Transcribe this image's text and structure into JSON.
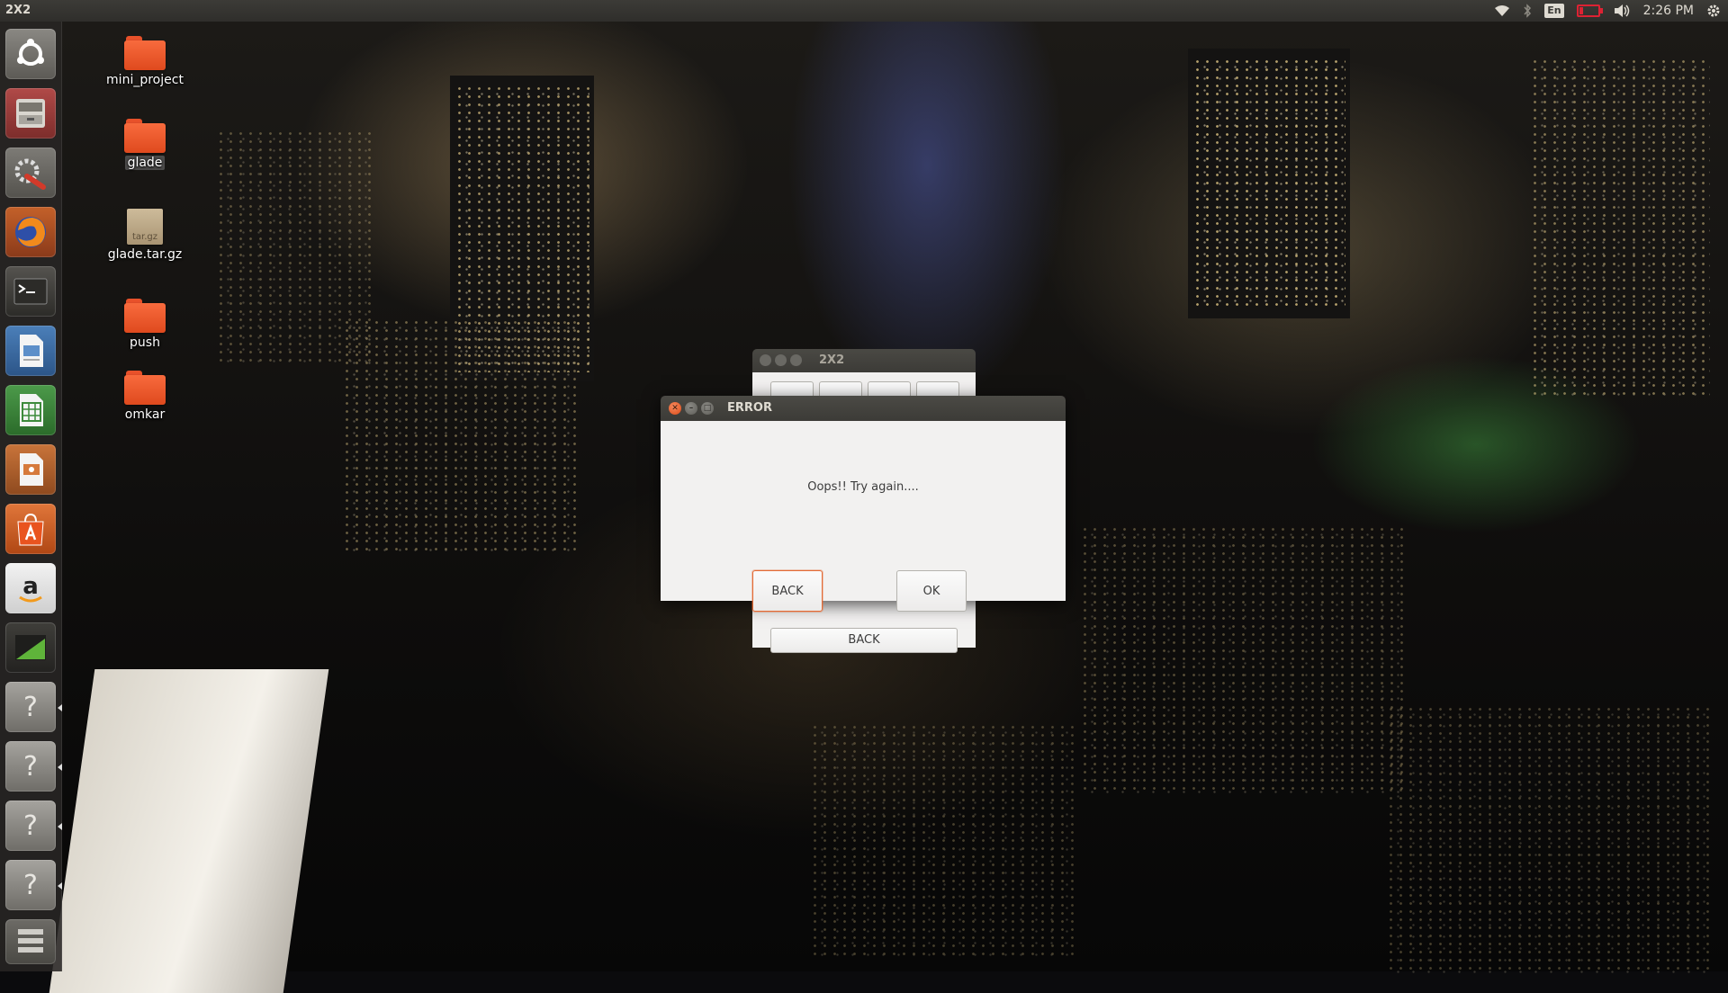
{
  "top_panel": {
    "app_title": "2X2",
    "keyboard_layout": "En",
    "clock": "2:26 PM",
    "icons": [
      "wifi-icon",
      "bluetooth-icon",
      "keyboard-layout-icon",
      "battery-icon",
      "volume-icon",
      "settings-gear-icon"
    ]
  },
  "launcher": {
    "items": [
      {
        "name": "dash-home",
        "icon": "ubuntu-logo-icon"
      },
      {
        "name": "files",
        "icon": "file-cabinet-icon"
      },
      {
        "name": "system-settings",
        "icon": "settings-wrench-icon"
      },
      {
        "name": "firefox",
        "icon": "firefox-icon"
      },
      {
        "name": "terminal",
        "icon": "terminal-icon"
      },
      {
        "name": "libreoffice-writer",
        "icon": "document-icon"
      },
      {
        "name": "libreoffice-calc",
        "icon": "spreadsheet-icon"
      },
      {
        "name": "libreoffice-impress",
        "icon": "presentation-icon"
      },
      {
        "name": "software-center",
        "icon": "shopping-bag-icon"
      },
      {
        "name": "amazon",
        "icon": "amazon-icon"
      },
      {
        "name": "system-monitor",
        "icon": "chart-icon"
      },
      {
        "name": "unknown-app-1",
        "icon": "question-mark-icon"
      },
      {
        "name": "unknown-app-2",
        "icon": "question-mark-icon"
      },
      {
        "name": "unknown-app-3",
        "icon": "question-mark-icon"
      },
      {
        "name": "unknown-app-4",
        "icon": "question-mark-icon"
      },
      {
        "name": "workspace-switcher",
        "icon": "workspaces-icon"
      }
    ]
  },
  "desktop_icons": [
    {
      "label": "mini_project",
      "type": "folder"
    },
    {
      "label": "glade",
      "type": "folder"
    },
    {
      "label": "glade.tar.gz",
      "type": "archive",
      "badge": "tar.gz"
    },
    {
      "label": "push",
      "type": "folder"
    },
    {
      "label": "omkar",
      "type": "folder"
    }
  ],
  "background_window": {
    "title": "2X2",
    "back_button_label": "BACK"
  },
  "error_dialog": {
    "title": "ERROR",
    "message": "Oops!! Try again....",
    "back_button_label": "BACK",
    "ok_button_label": "OK"
  },
  "colors": {
    "accent": "#e9541f",
    "panel": "#3c3b37",
    "dialog_bg": "#f2f1f0"
  }
}
